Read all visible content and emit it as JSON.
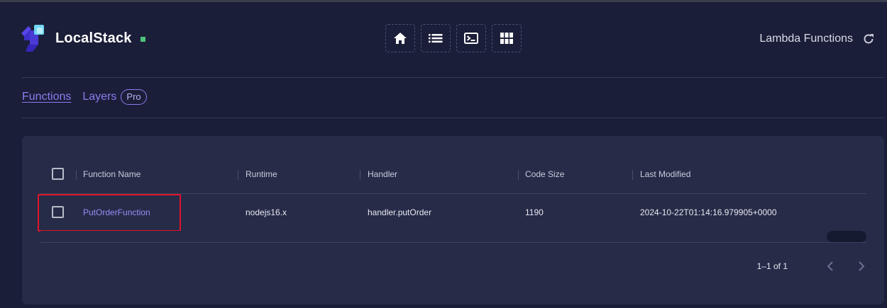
{
  "app": {
    "name": "LocalStack",
    "status_color": "#4ec27a"
  },
  "toolbar": {
    "buttons": [
      {
        "icon": "home-icon"
      },
      {
        "icon": "list-icon"
      },
      {
        "icon": "terminal-icon"
      },
      {
        "icon": "grid-icon"
      }
    ]
  },
  "header": {
    "title": "Lambda Functions",
    "refresh_icon": "refresh-icon"
  },
  "tabs": [
    {
      "label": "Functions",
      "active": true
    },
    {
      "label": "Layers",
      "active": false,
      "badge": "Pro"
    }
  ],
  "table": {
    "columns": [
      "Function Name",
      "Runtime",
      "Handler",
      "Code Size",
      "Last Modified"
    ],
    "rows": [
      {
        "function_name": "PutOrderFunction",
        "runtime": "nodejs16.x",
        "handler": "handler.putOrder",
        "code_size": "1190",
        "last_modified": "2024-10-22T01:14:16.979905+0000"
      }
    ]
  },
  "pagination": {
    "info": "1–1 of 1"
  },
  "colors": {
    "accent": "#8a7cf0",
    "background": "#1a1e38",
    "card": "#262b48",
    "highlight": "#e0142a"
  }
}
